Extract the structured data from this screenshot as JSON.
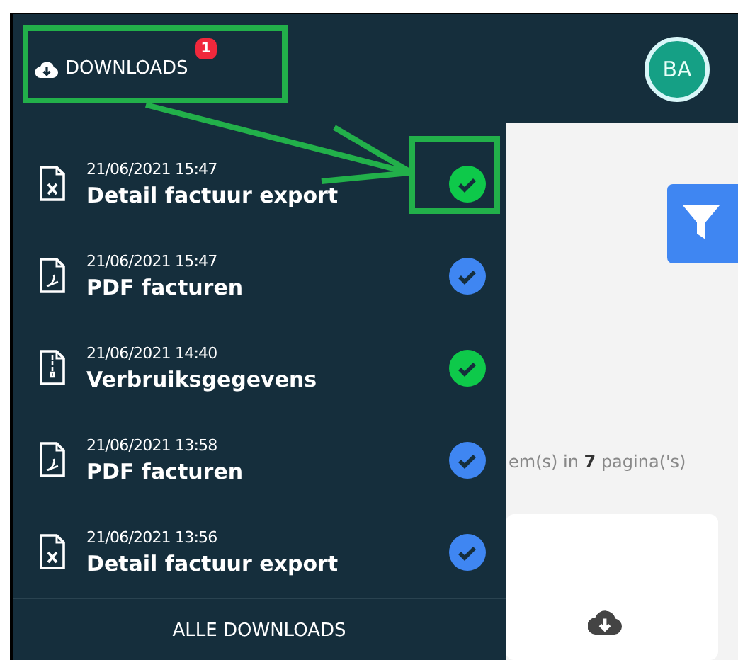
{
  "header": {
    "downloads_label": "DOWNLOADS",
    "badge": "1",
    "avatar": "BA"
  },
  "downloads": [
    {
      "kind": "excel",
      "date": "21/06/2021 15:47",
      "name": "Detail factuur export",
      "color": "#0ec94a"
    },
    {
      "kind": "pdf",
      "date": "21/06/2021 15:47",
      "name": "PDF facturen",
      "color": "#3f86f2"
    },
    {
      "kind": "zip",
      "date": "21/06/2021 14:40",
      "name": "Verbruiksgegevens",
      "color": "#0ec94a"
    },
    {
      "kind": "pdf",
      "date": "21/06/2021 13:58",
      "name": "PDF facturen",
      "color": "#3f86f2"
    },
    {
      "kind": "excel",
      "date": "21/06/2021 13:56",
      "name": "Detail factuur export",
      "color": "#3f86f2"
    }
  ],
  "all_downloads": "ALLE DOWNLOADS",
  "content": {
    "pagination_text": "em(s) in **7** pagina('s)"
  }
}
